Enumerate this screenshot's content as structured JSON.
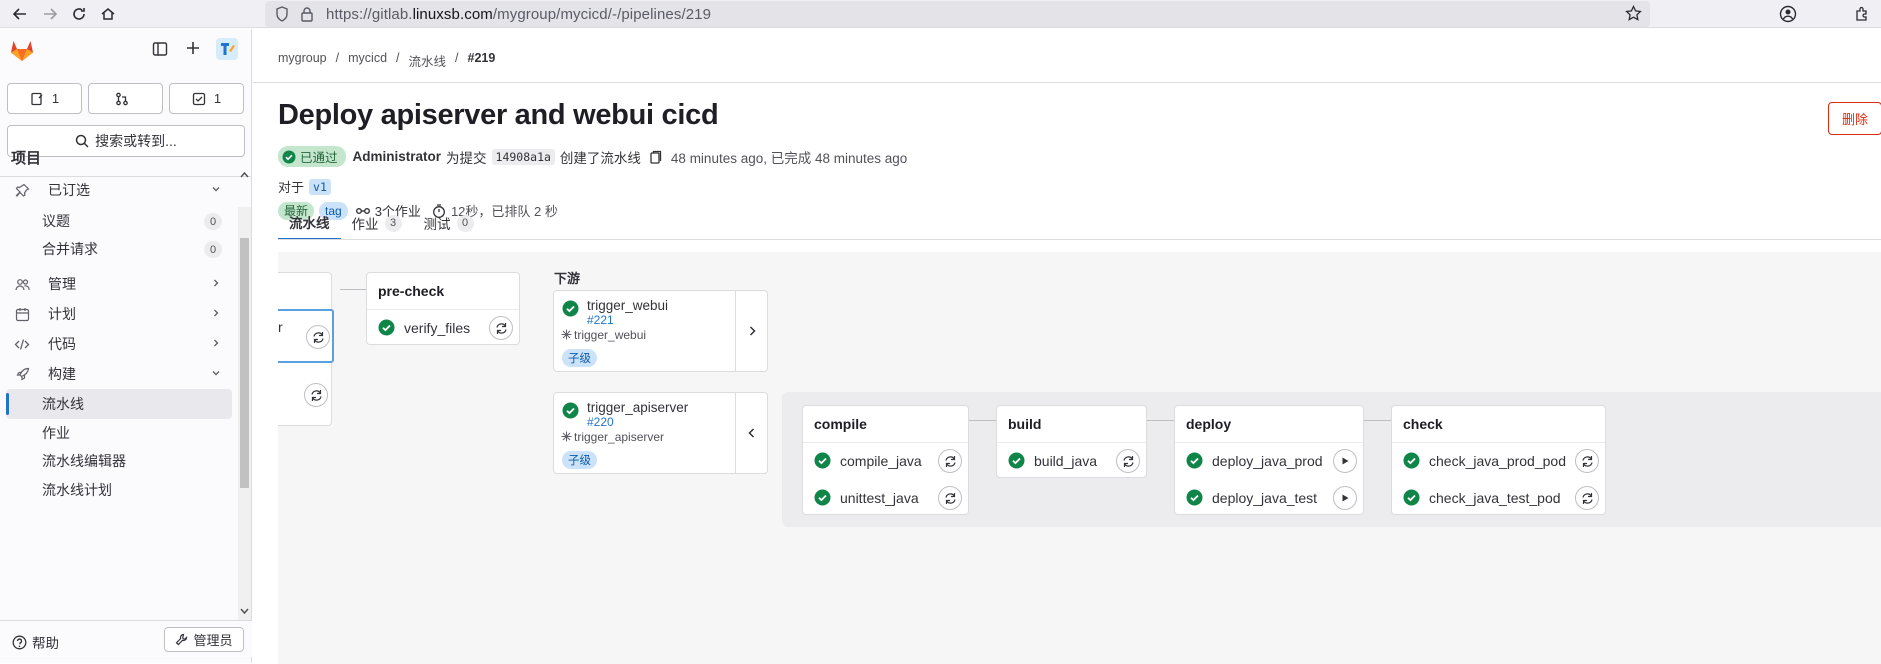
{
  "browser": {
    "url_prefix": "https://gitlab.",
    "url_domain": "linuxsb.com",
    "url_path": "/mygroup/mycicd/-/pipelines/219"
  },
  "sidebar": {
    "counters": {
      "issues": "1",
      "merge_requests": "",
      "todos": "1"
    },
    "search_label": "搜索或转到...",
    "project_label": "项目",
    "items": [
      {
        "label": "已订选",
        "icon": "pin-icon",
        "chevron": "down"
      },
      {
        "label": "议题",
        "count": "0"
      },
      {
        "label": "合并请求",
        "count": "0"
      },
      {
        "label": "管理",
        "icon": "users-icon",
        "chevron": "right"
      },
      {
        "label": "计划",
        "icon": "calendar-icon",
        "chevron": "right"
      },
      {
        "label": "代码",
        "icon": "code-icon",
        "chevron": "right"
      },
      {
        "label": "构建",
        "icon": "rocket-icon",
        "chevron": "down"
      },
      {
        "label": "流水线",
        "active": true
      },
      {
        "label": "作业"
      },
      {
        "label": "流水线编辑器"
      },
      {
        "label": "流水线计划"
      }
    ],
    "help_label": "帮助",
    "admin_label": "管理员"
  },
  "breadcrumb": [
    "mygroup",
    "mycicd",
    "流水线",
    "#219"
  ],
  "pipeline": {
    "title": "Deploy apiserver and webui cicd",
    "delete_label": "删除",
    "status_label": "已通过",
    "author": "Administrator",
    "commit_prefix": "为提交",
    "commit_sha": "14908a1a",
    "created_text": "创建了流水线",
    "time_text": "48 minutes ago, 已完成 48 minutes ago",
    "ref_prefix": "对于",
    "ref": "v1",
    "latest_badge": "最新",
    "tag_badge": "tag",
    "jobs_text": "3个作业",
    "duration_text": "12秒，已排队 2 秒"
  },
  "tabs": [
    {
      "label": "流水线",
      "count": "",
      "active": true
    },
    {
      "label": "作业",
      "count": "3"
    },
    {
      "label": "测试",
      "count": "0"
    }
  ],
  "graph": {
    "partial_stage_job": "r",
    "precheck": {
      "title": "pre-check",
      "jobs": [
        "verify_files"
      ]
    },
    "downstream_label": "下游",
    "downstream": [
      {
        "name": "trigger_webui",
        "id": "#221",
        "source": "trigger_webui",
        "type": "子级"
      },
      {
        "name": "trigger_apiserver",
        "id": "#220",
        "source": "trigger_apiserver",
        "type": "子级"
      }
    ],
    "child_stages": [
      {
        "title": "compile",
        "jobs": [
          "compile_java",
          "unittest_java"
        ],
        "action": "retry"
      },
      {
        "title": "build",
        "jobs": [
          "build_java"
        ],
        "action": "retry"
      },
      {
        "title": "deploy",
        "jobs": [
          "deploy_java_prod",
          "deploy_java_test"
        ],
        "action": "play"
      },
      {
        "title": "check",
        "jobs": [
          "check_java_prod_pod",
          "check_java_test_pod"
        ],
        "action": "retry"
      }
    ]
  },
  "colors": {
    "success": "#108548",
    "link": "#1f75cb",
    "danger": "#dd2b0e"
  }
}
